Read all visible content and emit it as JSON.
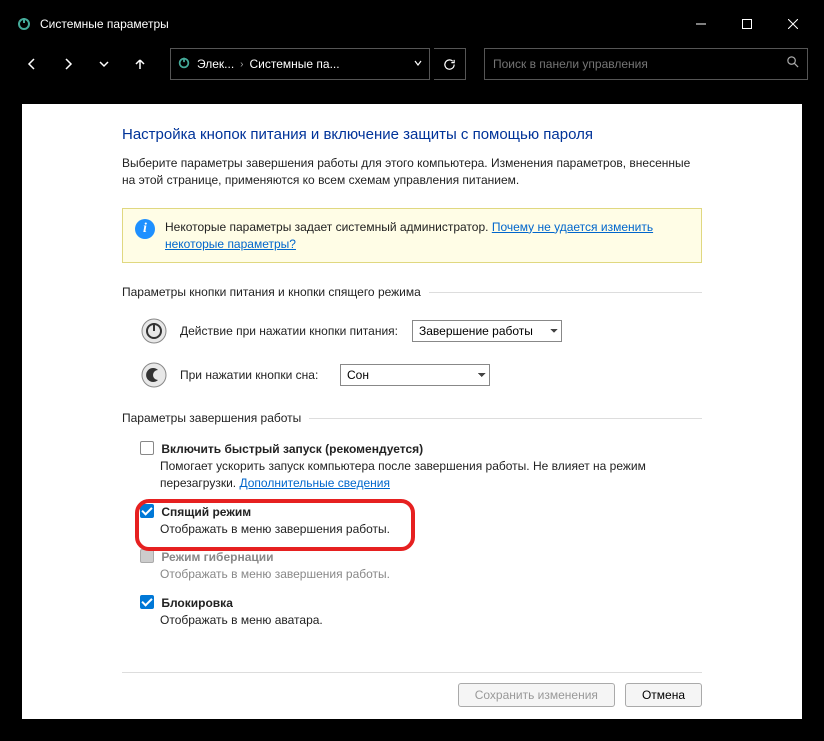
{
  "window": {
    "title": "Системные параметры"
  },
  "breadcrumb": {
    "item1": "Элек...",
    "item2": "Системные па..."
  },
  "search": {
    "placeholder": "Поиск в панели управления"
  },
  "page": {
    "heading": "Настройка кнопок питания и включение защиты с помощью пароля",
    "sub": "Выберите параметры завершения работы для этого компьютера. Изменения параметров, внесенные на этой странице, применяются ко всем схемам управления питанием."
  },
  "info": {
    "text": "Некоторые параметры задает системный администратор. ",
    "link": "Почему не удается изменить некоторые параметры?"
  },
  "section1": {
    "title": "Параметры кнопки питания и кнопки спящего режима",
    "row1_label": "Действие при нажатии кнопки питания:",
    "row1_value": "Завершение работы",
    "row2_label": "При нажатии кнопки сна:",
    "row2_value": "Сон"
  },
  "section2": {
    "title": "Параметры завершения работы",
    "items": [
      {
        "label": "Включить быстрый запуск (рекомендуется)",
        "desc_pre": "Помогает ускорить запуск компьютера после завершения работы. Не влияет на режим перезагрузки. ",
        "desc_link": "Дополнительные сведения",
        "checked": false,
        "disabled": false
      },
      {
        "label": "Спящий режим",
        "desc": "Отображать в меню завершения работы.",
        "checked": true,
        "disabled": false
      },
      {
        "label": "Режим гибернации",
        "desc": "Отображать в меню завершения работы.",
        "checked": false,
        "disabled": true
      },
      {
        "label": "Блокировка",
        "desc": "Отображать в меню аватара.",
        "checked": true,
        "disabled": false
      }
    ]
  },
  "footer": {
    "save": "Сохранить изменения",
    "cancel": "Отмена"
  }
}
